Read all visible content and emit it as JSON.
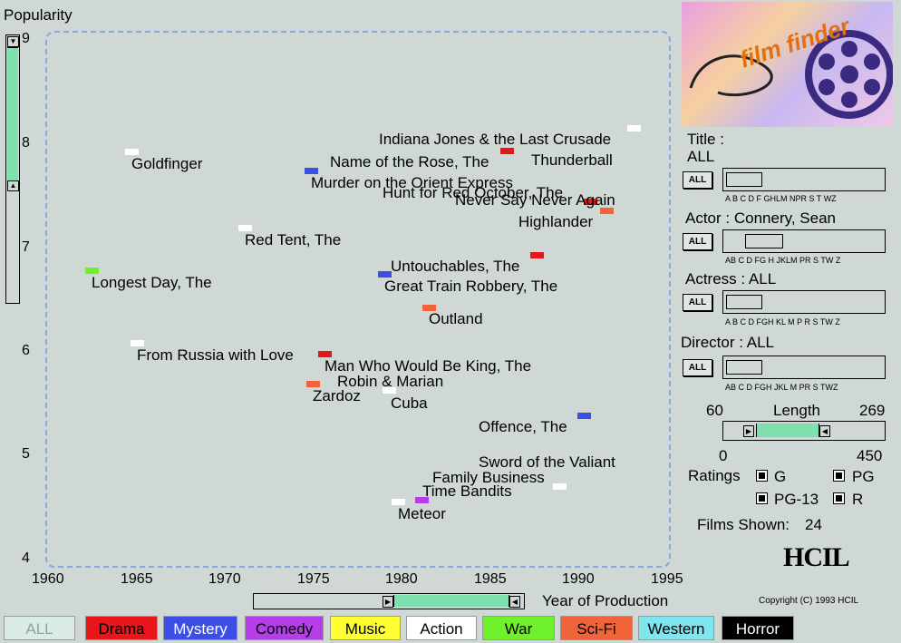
{
  "axis": {
    "y_title": "Popularity",
    "y_ticks": [
      "9",
      "8",
      "7",
      "6",
      "5",
      "4"
    ],
    "x_ticks": [
      "1960",
      "1965",
      "1970",
      "1975",
      "1980",
      "1985",
      "1990",
      "1995"
    ],
    "x_title": "Year of Production"
  },
  "films": [
    {
      "title": "Indiana Jones & the Last Crusade"
    },
    {
      "title": "Thunderball"
    },
    {
      "title": "Goldfinger"
    },
    {
      "title": "Name of the Rose, The"
    },
    {
      "title": "Murder on the Orient Express"
    },
    {
      "title": "Hunt for Red October, The"
    },
    {
      "title": "Never Say Never Again"
    },
    {
      "title": "Highlander"
    },
    {
      "title": "Red Tent, The"
    },
    {
      "title": "Untouchables, The"
    },
    {
      "title": "Longest Day, The"
    },
    {
      "title": "Great Train Robbery, The"
    },
    {
      "title": "Outland"
    },
    {
      "title": "From Russia with Love"
    },
    {
      "title": "Man Who Would Be King, The"
    },
    {
      "title": "Robin & Marian"
    },
    {
      "title": "Zardoz"
    },
    {
      "title": "Cuba"
    },
    {
      "title": "Offence, The"
    },
    {
      "title": "Sword of the Valiant"
    },
    {
      "title": "Family Business"
    },
    {
      "title": "Time Bandits"
    },
    {
      "title": "Meteor"
    }
  ],
  "filters": {
    "title_label": "Title :",
    "title_value": "ALL",
    "title_letters": "A B C D F GHLM NPR S  T  WZ",
    "actor_label": "Actor : Connery, Sean",
    "actor_letters": "AB  C   D  FG H  JKLM   PR S  TW Z",
    "actress_label": "Actress : ALL",
    "actress_letters": "A B  C  D FGH KL M  P R S  TW Z",
    "director_label": "Director : ALL",
    "director_letters": "AB  C  D FGH JKL M  PR S   TWZ",
    "all_button": "ALL",
    "length_label": "Length",
    "length_min": "60",
    "length_max": "269",
    "length_scale_min": "0",
    "length_scale_max": "450",
    "ratings_label": "Ratings",
    "rating_g": "G",
    "rating_pg": "PG",
    "rating_pg13": "PG-13",
    "rating_r": "R",
    "films_shown_label": "Films Shown:",
    "films_shown_value": "24"
  },
  "logo": {
    "text": "film finder",
    "org": "HCIL",
    "copyright": "Copyright (C) 1993 HCIL"
  },
  "genres": [
    "ALL",
    "Drama",
    "Mystery",
    "Comedy",
    "Music",
    "Action",
    "War",
    "Sci-Fi",
    "Western",
    "Horror"
  ],
  "colors": {
    "drama": "#e8151b",
    "mystery": "#3b4ee6",
    "comedy": "#b63ee8",
    "music": "#ffff33",
    "action": "#ffffff",
    "war": "#6ef02a",
    "scifi": "#f0643a",
    "western": "#7fe6ef",
    "horror": "#000000",
    "slider_fill": "#7ee0ac"
  }
}
